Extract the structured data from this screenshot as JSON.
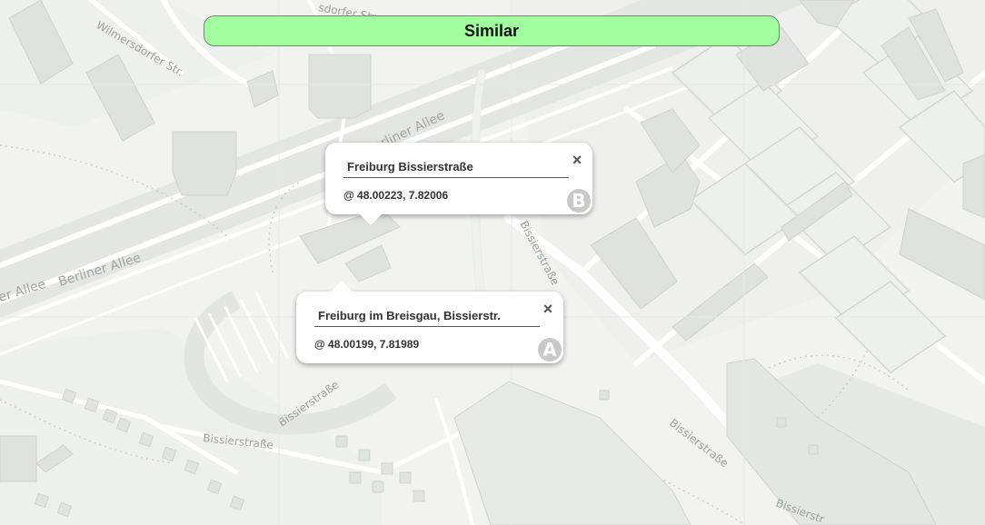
{
  "verdict": {
    "label": "Similar",
    "color": "#a2ff9f"
  },
  "popups": [
    {
      "id": "B",
      "title": "Freiburg Bissierstraße",
      "coords": "@ 48.00223, 7.82006",
      "badge": "B",
      "close_icon": "×"
    },
    {
      "id": "A",
      "title": "Freiburg im Breisgau, Bissierstr.",
      "coords": "@ 48.00199, 7.81989",
      "badge": "A",
      "close_icon": "×"
    }
  ],
  "map": {
    "streets": {
      "wilmersdorfer": "Wilmersdorfer Str.",
      "berliner_top": "Berliner Allee",
      "berliner_mid": "Berliner Allee",
      "berliner_left": "er Allee",
      "bissier_1": "Bissierstraße",
      "bissier_2": "Bissierstraße",
      "bissier_3": "Bissierstraße",
      "bissier_4": "Bissierstraße",
      "bissier_5": "Bissierstr",
      "dorfer_top": "sdorfer Str."
    }
  }
}
